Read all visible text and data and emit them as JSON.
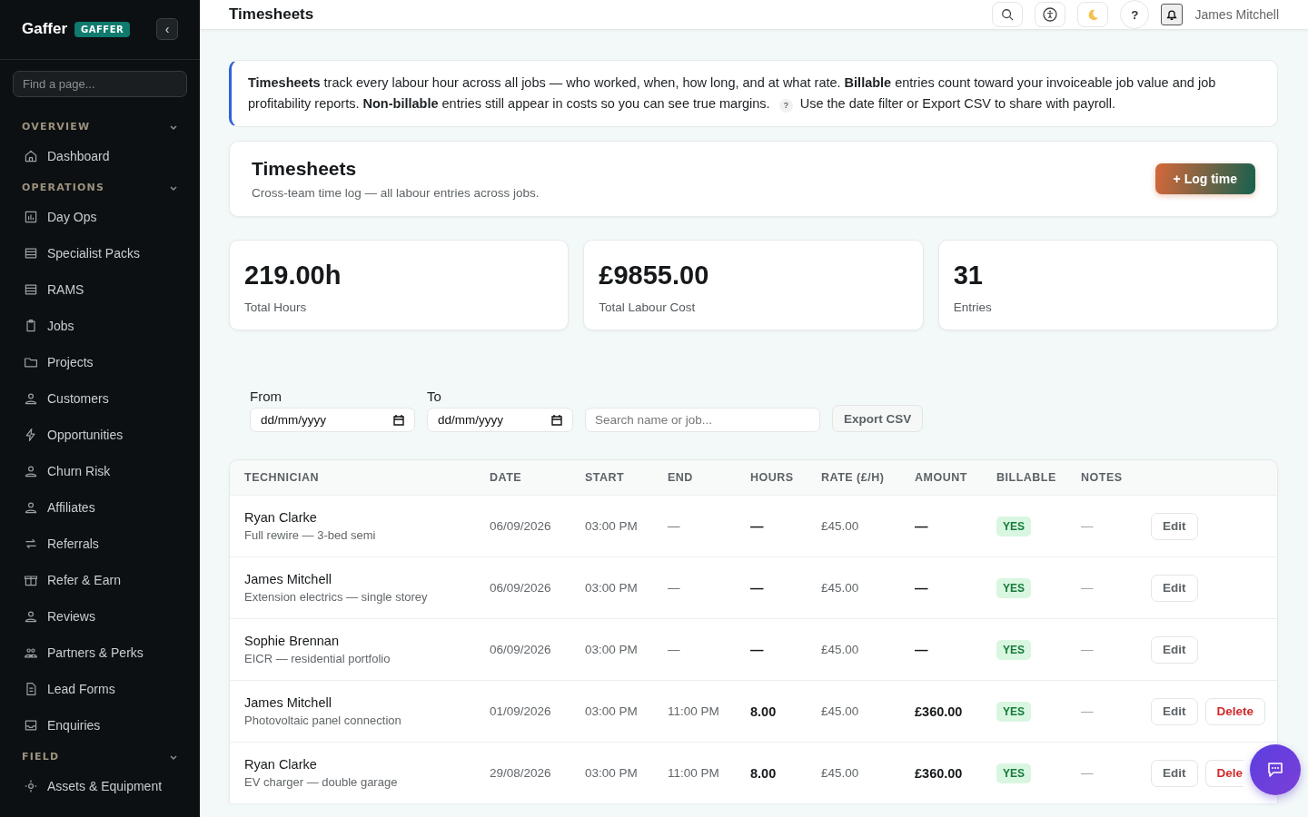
{
  "sidebar": {
    "brand": "Gaffer",
    "badge": "GAFFER",
    "collapse": "‹",
    "search": {
      "placeholder": "Find a page..."
    },
    "sections": [
      {
        "title": "OVERVIEW",
        "expanded": true,
        "items": [
          {
            "label": "Dashboard"
          }
        ]
      },
      {
        "title": "OPERATIONS",
        "expanded": true,
        "items": [
          {
            "label": "Day Ops"
          },
          {
            "label": "Specialist Packs"
          },
          {
            "label": "RAMS"
          },
          {
            "label": "Jobs"
          },
          {
            "label": "Projects"
          },
          {
            "label": "Customers"
          },
          {
            "label": "Opportunities"
          },
          {
            "label": "Churn Risk"
          },
          {
            "label": "Affiliates"
          },
          {
            "label": "Referrals"
          },
          {
            "label": "Refer & Earn"
          },
          {
            "label": "Reviews"
          },
          {
            "label": "Partners & Perks"
          },
          {
            "label": "Lead Forms"
          },
          {
            "label": "Enquiries"
          }
        ]
      },
      {
        "title": "FIELD",
        "expanded": true,
        "items": [
          {
            "label": "Assets & Equipment"
          }
        ]
      }
    ]
  },
  "topbar": {
    "title": "Timesheets",
    "help": "?",
    "user": "James Mitchell"
  },
  "info": {
    "text": "**Timesheets** track every labour hour across all jobs — who worked, when, how long, and at what rate. **Billable** entries count toward your invoiceable job value and job profitability reports. **Non-billable** entries still appear in costs so you can see true margins.",
    "hint_icon": "?",
    "hint": "Use the date filter or Export CSV to share with payroll."
  },
  "header": {
    "title": "Timesheets",
    "subtitle": "Cross-team time log — all labour entries across jobs.",
    "action": "+ Log time"
  },
  "stats": [
    {
      "value": "219.00h",
      "label": "Total Hours"
    },
    {
      "value": "£9855.00",
      "label": "Total Labour Cost"
    },
    {
      "value": "31",
      "label": "Entries"
    }
  ],
  "filters": {
    "from_label": "From",
    "from_placeholder": "dd/mm/yyyy",
    "to_label": "To",
    "to_placeholder": "dd/mm/yyyy",
    "search": {
      "placeholder": "Search name or job..."
    },
    "export": "Export CSV"
  },
  "table": {
    "columns": [
      "TECHNICIAN",
      "DATE",
      "START",
      "END",
      "HOURS",
      "RATE (£/H)",
      "AMOUNT",
      "BILLABLE",
      "NOTES"
    ],
    "rows": [
      {
        "name": "Ryan Clarke",
        "job": "Full rewire — 3-bed semi",
        "date": "06/09/2026",
        "start": "03:00 PM",
        "end": "—",
        "hours": "—",
        "rate": "£45.00",
        "amount": "—",
        "billable": "YES",
        "notes": "—",
        "edit": "Edit"
      },
      {
        "name": "James Mitchell",
        "job": "Extension electrics — single storey",
        "date": "06/09/2026",
        "start": "03:00 PM",
        "end": "—",
        "hours": "—",
        "rate": "£45.00",
        "amount": "—",
        "billable": "YES",
        "notes": "—",
        "edit": "Edit"
      },
      {
        "name": "Sophie Brennan",
        "job": "EICR — residential portfolio",
        "date": "06/09/2026",
        "start": "03:00 PM",
        "end": "—",
        "hours": "—",
        "rate": "£45.00",
        "amount": "—",
        "billable": "YES",
        "notes": "—",
        "edit": "Edit"
      },
      {
        "name": "James Mitchell",
        "job": "Photovoltaic panel connection",
        "date": "01/09/2026",
        "start": "03:00 PM",
        "end": "11:00 PM",
        "hours": "8.00",
        "rate": "£45.00",
        "amount": "£360.00",
        "billable": "YES",
        "notes": "—",
        "edit": "Edit",
        "delete": "Delete"
      },
      {
        "name": "Ryan Clarke",
        "job": "EV charger — double garage",
        "date": "29/08/2026",
        "start": "03:00 PM",
        "end": "11:00 PM",
        "hours": "8.00",
        "rate": "£45.00",
        "amount": "£360.00",
        "billable": "YES",
        "notes": "—",
        "edit": "Edit",
        "delete": "Dele"
      }
    ]
  }
}
